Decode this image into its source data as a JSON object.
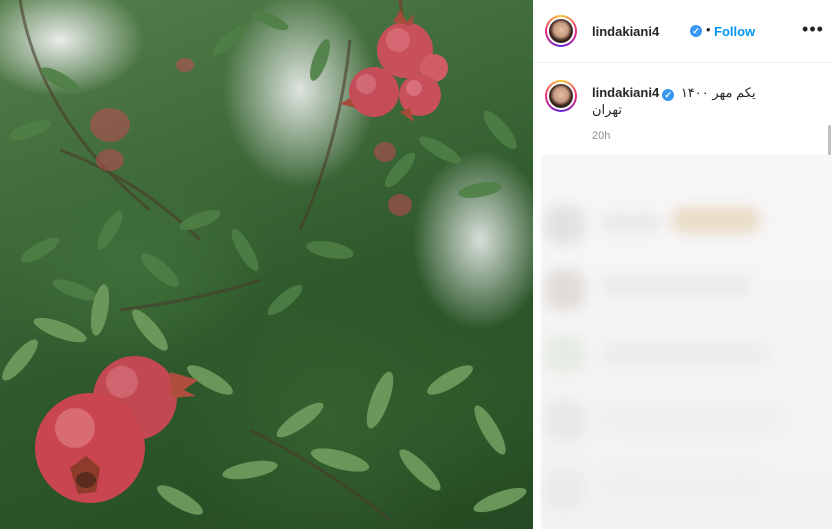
{
  "post": {
    "author": {
      "username": "lindakiani4",
      "verified_icon": "✓"
    },
    "follow_label": "Follow",
    "separator": "•",
    "more_icon": "•••",
    "caption": {
      "username": "lindakiani4",
      "text": "یکم مهر ۱۴۰۰",
      "location_text": "تهران",
      "time": "20h"
    }
  },
  "colors": {
    "follow_blue": "#0095f6",
    "verified_blue": "#3897f0",
    "time_gray": "#8e8e8e"
  }
}
